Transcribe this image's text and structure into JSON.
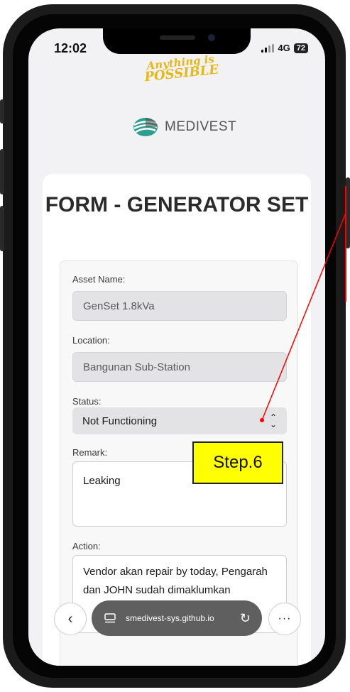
{
  "status_bar": {
    "time": "12:02",
    "network": "4G",
    "battery": "72"
  },
  "header": {
    "slogan_line1": "Anything is",
    "slogan_line2": "POSSIBLE",
    "brand": "MEDIVEST"
  },
  "form": {
    "title": "FORM - GENERATOR SET",
    "fields": {
      "asset_name": {
        "label": "Asset Name:",
        "value": "GenSet 1.8kVa"
      },
      "location": {
        "label": "Location:",
        "value": "Bangunan Sub-Station"
      },
      "status": {
        "label": "Status:",
        "value": "Not Functioning"
      },
      "remark": {
        "label": "Remark:",
        "value": "Leaking"
      },
      "action": {
        "label": "Action:",
        "value": "Vendor akan repair by today, Pengarah dan JOHN sudah dimaklumkan"
      }
    }
  },
  "browser": {
    "url": "smedivest-sys.github.io"
  },
  "annotation": {
    "label": "Step.6",
    "color": "#ff0000",
    "box_color": "#ffff00"
  },
  "colors": {
    "slogan": "#e5b816",
    "url_pill": "#5f5f5f",
    "screen_bg": "#f2f2f4"
  }
}
